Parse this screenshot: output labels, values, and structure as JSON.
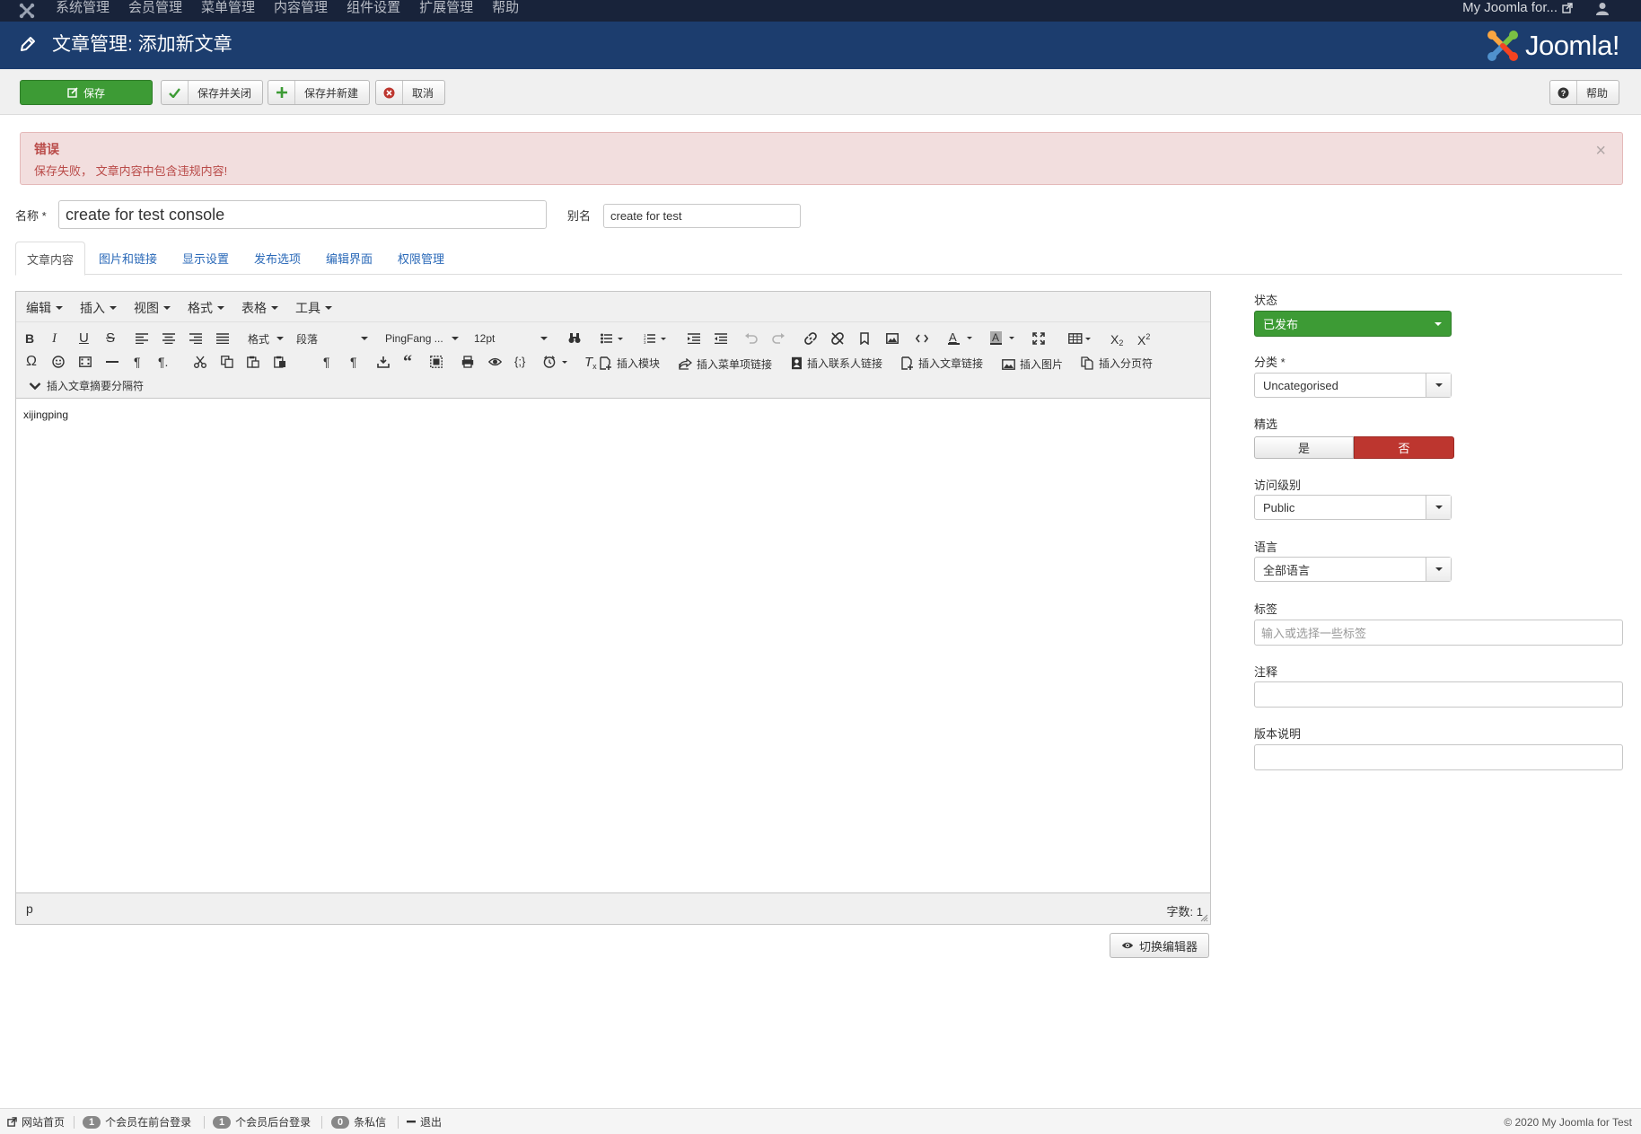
{
  "top_nav": {
    "items": [
      "系统管理",
      "会员管理",
      "菜单管理",
      "内容管理",
      "组件设置",
      "扩展管理",
      "帮助"
    ],
    "site_name": "My Joomla for...",
    "user_icon": "user-icon"
  },
  "header": {
    "title": "文章管理: 添加新文章",
    "brand": "Joomla!"
  },
  "toolbar": {
    "save": "保存",
    "save_close": "保存并关闭",
    "save_new": "保存并新建",
    "cancel": "取消",
    "help": "帮助"
  },
  "alert": {
    "heading": "错误",
    "message": "保存失败， 文章内容中包含违规内容!",
    "close": "×"
  },
  "form": {
    "title_label": "名称 *",
    "title_value": "create for test console",
    "alias_label": "别名",
    "alias_value": "create for test"
  },
  "tabs": [
    "文章内容",
    "图片和链接",
    "显示设置",
    "发布选项",
    "编辑界面",
    "权限管理"
  ],
  "editor": {
    "menus": [
      "编辑",
      "插入",
      "视图",
      "格式",
      "表格",
      "工具"
    ],
    "format_select": "格式",
    "block_select": "段落",
    "font_select": "PingFang ...",
    "size_select": "12pt",
    "buttons": {
      "insert_module": "插入模块",
      "insert_menu_link": "插入菜单项链接",
      "insert_contact_link": "插入联系人链接",
      "insert_article_link": "插入文章链接",
      "insert_image": "插入图片",
      "insert_pagebreak": "插入分页符",
      "insert_readmore": "插入文章摘要分隔符"
    },
    "content": "xijingping",
    "path": "p",
    "word_count": "字数: 1",
    "toggle": "切换编辑器"
  },
  "sidebar": {
    "status_label": "状态",
    "status_value": "已发布",
    "category_label": "分类 *",
    "category_value": "Uncategorised",
    "featured_label": "精选",
    "featured_yes": "是",
    "featured_no": "否",
    "access_label": "访问级别",
    "access_value": "Public",
    "language_label": "语言",
    "language_value": "全部语言",
    "tags_label": "标签",
    "tags_placeholder": "输入或选择一些标签",
    "note_label": "注释",
    "version_label": "版本说明"
  },
  "footer": {
    "site_home": "网站首页",
    "frontend_count": "1",
    "frontend_text": "个会员在前台登录",
    "backend_count": "1",
    "backend_text": "个会员后台登录",
    "messages_count": "0",
    "messages_text": "条私信",
    "logout": "退出",
    "copyright": "© 2020 My Joomla for Test"
  },
  "colors": {
    "topbar": "#18233a",
    "header": "#1c3d6e",
    "save_green": "#3d9b35",
    "no_red": "#bd362f",
    "alert_bg": "#f2dede",
    "alert_text": "#b94a48",
    "link_blue": "#2a69b8"
  }
}
